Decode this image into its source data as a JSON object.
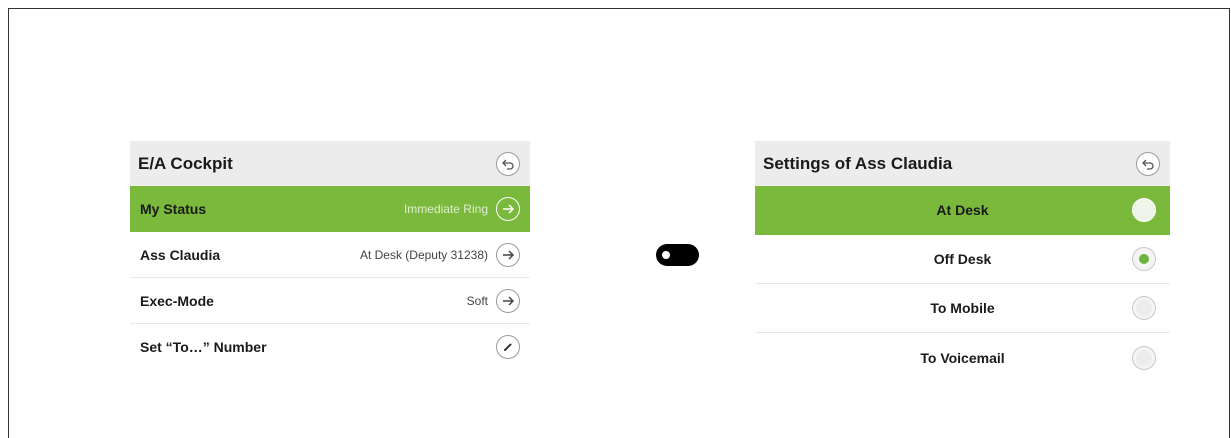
{
  "left_panel": {
    "title": "E/A Cockpit",
    "back_icon": "undo-arrow-icon",
    "rows": [
      {
        "label": "My Status",
        "value": "Immediate Ring",
        "action_icon": "arrow-right-icon",
        "active": true
      },
      {
        "label": "Ass Claudia",
        "value": "At Desk (Deputy 31238)",
        "action_icon": "arrow-right-icon",
        "active": false
      },
      {
        "label": "Exec-Mode",
        "value": "Soft",
        "action_icon": "arrow-right-icon",
        "active": false
      },
      {
        "label": "Set “To…” Number",
        "value": "",
        "action_icon": "pencil-icon",
        "active": false
      }
    ]
  },
  "toggle": {
    "state": "off",
    "icon": "toggle-switch-icon"
  },
  "right_panel": {
    "title": "Settings of Ass Claudia",
    "back_icon": "undo-arrow-icon",
    "options": [
      {
        "label": "At Desk",
        "highlighted": true,
        "selected": false
      },
      {
        "label": "Off Desk",
        "highlighted": false,
        "selected": true
      },
      {
        "label": "To Mobile",
        "highlighted": false,
        "selected": false
      },
      {
        "label": "To Voicemail",
        "highlighted": false,
        "selected": false
      }
    ]
  },
  "colors": {
    "accent_green": "#7ab93c",
    "radio_selected": "#6db33f",
    "header_gray": "#ececec"
  }
}
